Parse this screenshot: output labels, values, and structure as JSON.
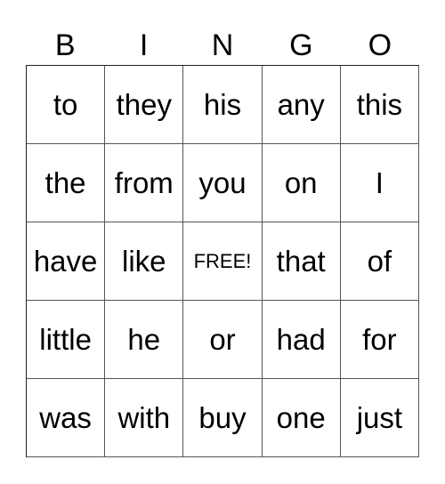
{
  "header": {
    "letters": [
      "B",
      "I",
      "N",
      "G",
      "O"
    ]
  },
  "board": {
    "rows": [
      [
        "to",
        "they",
        "his",
        "any",
        "this"
      ],
      [
        "the",
        "from",
        "you",
        "on",
        "I"
      ],
      [
        "have",
        "like",
        "FREE!",
        "that",
        "of"
      ],
      [
        "little",
        "he",
        "or",
        "had",
        "for"
      ],
      [
        "was",
        "with",
        "buy",
        "one",
        "just"
      ]
    ],
    "free_label": "FREE!"
  }
}
